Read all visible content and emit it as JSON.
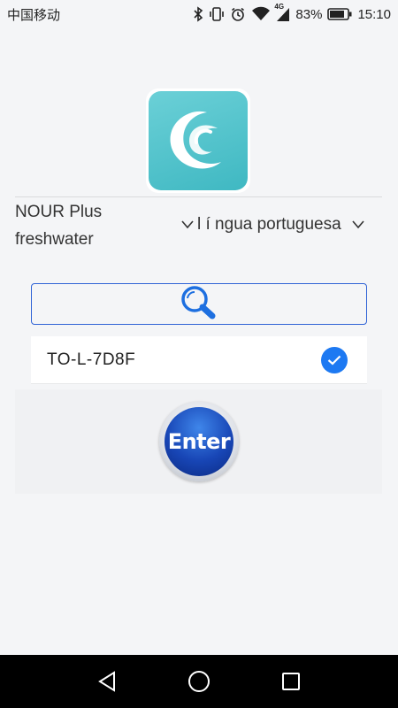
{
  "status_bar": {
    "carrier": "中国移动",
    "network_type": "4G",
    "battery_percent": "83%",
    "time": "15:10"
  },
  "app": {
    "logo_icon": "wave-logo-icon",
    "device_name": "NOUR Plus freshwater",
    "language_selector": "l í ngua portuguesa",
    "search_icon": "magnifier-icon",
    "devices": [
      {
        "name": "TO-L-7D8F",
        "selected": true
      }
    ],
    "enter_label": "Enter"
  },
  "nav_bar": {
    "back_icon": "triangle-back-icon",
    "home_icon": "circle-home-icon",
    "recents_icon": "square-recents-icon"
  },
  "colors": {
    "accent": "#1d79f2",
    "search_border": "#2f63d6",
    "logo_teal": "#4fc3cb",
    "enter_blue": "#1846b6"
  }
}
